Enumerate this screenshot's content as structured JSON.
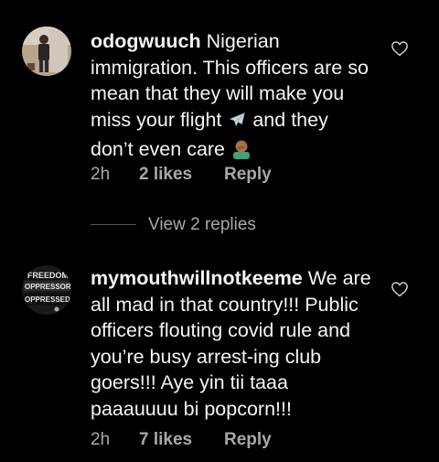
{
  "comments": [
    {
      "username": "odogwuuch",
      "text": "Nigerian immigration. This officers are so mean that they will make you miss your flight",
      "text_tail": "and they don’t even care",
      "emojis": [
        "airplane-emoji",
        "man-facepalming-emoji"
      ],
      "time": "2h",
      "likes": "2 likes",
      "reply": "Reply"
    },
    {
      "username": "mymouthwillnotkeeme",
      "text": "We are all mad in that country!!! Public officers flouting covid rule and you’re busy arrest-ing club goers!!! Aye yin tii taaa paaauuuu bi popcorn!!!",
      "time": "2h",
      "likes": "7 likes",
      "reply": "Reply",
      "avatar_text": [
        "FREEDOM",
        "OPPRESSOR:",
        "OPPRESSED"
      ]
    }
  ],
  "view_replies": "View 2 replies",
  "colors": {
    "background": "#000000",
    "text": "#f5f5f5",
    "muted": "#a8a8a8"
  },
  "icons": {
    "like": "heart-outline-icon"
  }
}
